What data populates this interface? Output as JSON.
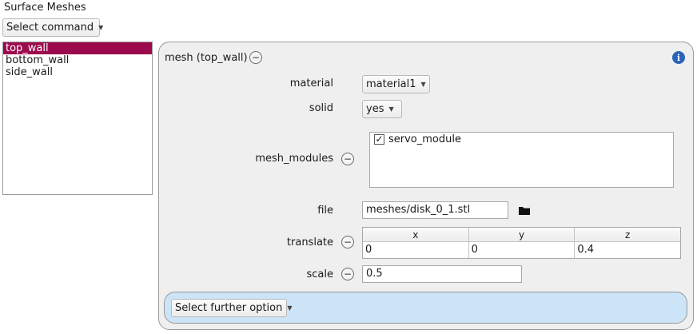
{
  "window": {
    "title": "Surface Meshes"
  },
  "command_select": {
    "value": "Select command"
  },
  "mesh_list": {
    "items": [
      "top_wall",
      "bottom_wall",
      "side_wall"
    ],
    "selected": "top_wall"
  },
  "panel": {
    "header": "mesh (top_wall)",
    "material": {
      "label": "material",
      "value": "material1"
    },
    "solid": {
      "label": "solid",
      "value": "yes"
    },
    "mesh_modules": {
      "label": "mesh_modules",
      "items": [
        {
          "label": "servo_module",
          "checked": true
        }
      ]
    },
    "file": {
      "label": "file",
      "value": "meshes/disk_0_1.stl"
    },
    "translate": {
      "label": "translate",
      "columns": [
        "x",
        "y",
        "z"
      ],
      "values": [
        "0",
        "0",
        "0.4"
      ]
    },
    "scale": {
      "label": "scale",
      "value": "0.5"
    },
    "further": {
      "value": "Select further option"
    }
  },
  "icons": {
    "collapse": "minus-circle-icon",
    "info": "info-icon",
    "folder": "folder-icon",
    "dropdown": "dropdown-arrow-icon",
    "check": "check-icon"
  },
  "colors": {
    "selection": "#9c0a4e",
    "further_bg": "#cce4f7",
    "info": "#2a64b8"
  }
}
